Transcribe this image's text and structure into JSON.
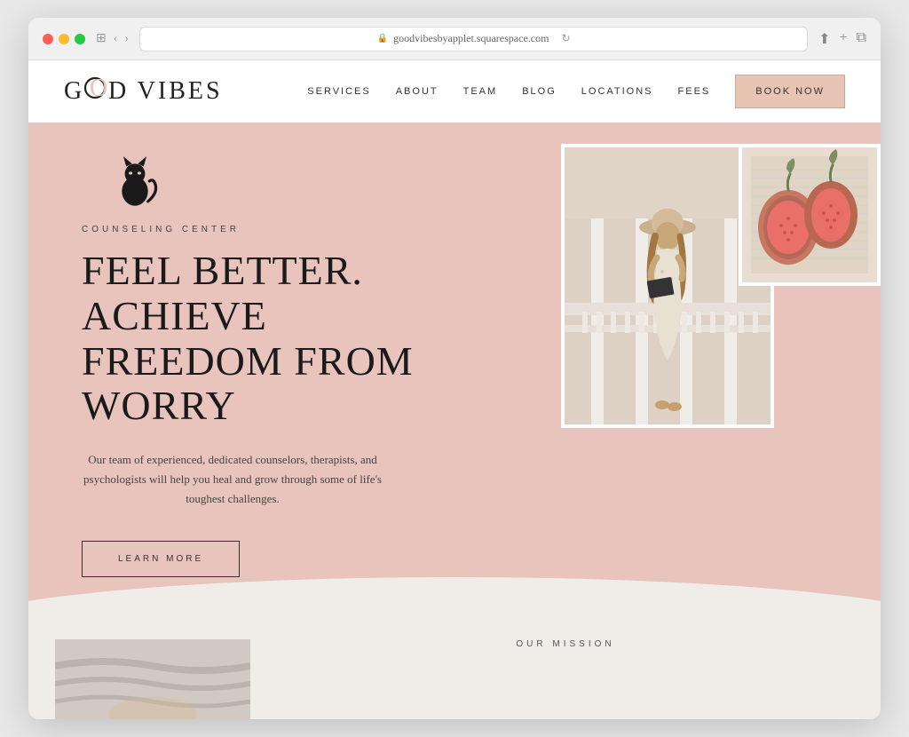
{
  "browser": {
    "url": "goodvibesbyapplet.squarespace.com",
    "reload_icon": "↻"
  },
  "nav": {
    "logo": "GOOD VIBES",
    "links": [
      {
        "label": "SERVICES",
        "id": "services"
      },
      {
        "label": "ABOUT",
        "id": "about"
      },
      {
        "label": "TEAM",
        "id": "team"
      },
      {
        "label": "BLOG",
        "id": "blog"
      },
      {
        "label": "LOCATIONS",
        "id": "locations"
      },
      {
        "label": "FEES",
        "id": "fees"
      }
    ],
    "book_now": "BOOK NOW"
  },
  "hero": {
    "counseling_label": "COUNSELING CENTER",
    "title_line1": "FEEL BETTER. ACHIEVE",
    "title_line2": "FREEDOM FROM WORRY",
    "description": "Our team of experienced, dedicated counselors, therapists, and psychologists will help you heal and grow through some of life's toughest challenges.",
    "learn_more": "LEARN MORE",
    "cat_icon": "🐱"
  },
  "bottom": {
    "our_mission": "OUR MISSION"
  }
}
